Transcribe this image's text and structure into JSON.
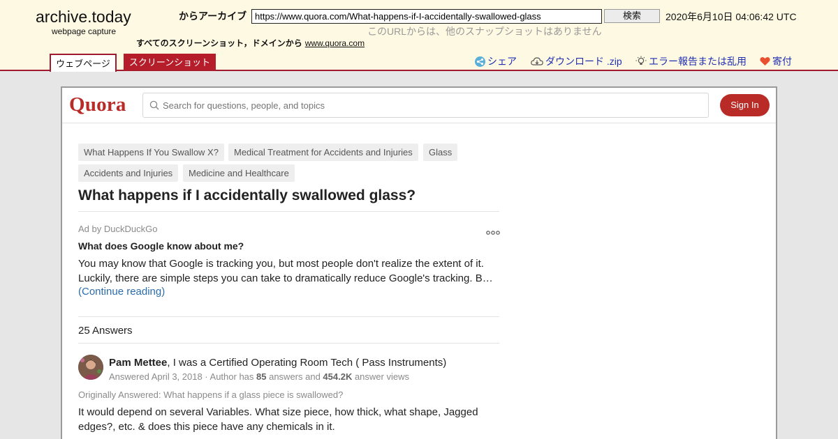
{
  "archive": {
    "logo": "archive.today",
    "logo_sub": "webpage capture",
    "from_label": "からアーカイブ",
    "url": "https://www.quora.com/What-happens-if-I-accidentally-swallowed-glass",
    "search_label": "検索",
    "date": "2020年6月10日 04:06:42 UTC",
    "no_other_snapshots": "このURLからは、他のスナップショットはありません",
    "all_screenshots_label": "すべてのスクリーンショット，ドメインから",
    "domain_link": "www.quora.com",
    "tabs": {
      "webpage": "ウェブページ",
      "screenshot": "スクリーンショット"
    },
    "actions": {
      "share": "シェア",
      "download": "ダウンロード .zip",
      "report": "エラー報告または乱用",
      "donate": "寄付"
    }
  },
  "quora": {
    "logo": "Quora",
    "search_placeholder": "Search for questions, people, and topics",
    "sign_in": "Sign In",
    "topics": [
      "What Happens If You Swallow X?",
      "Medical Treatment for Accidents and Injuries",
      "Glass",
      "Accidents and Injuries",
      "Medicine and Healthcare"
    ],
    "question_title": "What happens if I accidentally swallowed glass?",
    "ad": {
      "by": "Ad by DuckDuckGo",
      "title": "What does Google know about me?",
      "line1": "You may know that Google is tracking you, but most people don't realize the extent of it.",
      "line2": "Luckily, there are simple steps you can take to dramatically reduce Google's tracking. But…",
      "continue": "(Continue reading)"
    },
    "answers_count": "25 Answers",
    "answer": {
      "author_name": "Pam Mettee",
      "author_cred": ", I was a Certified Operating Room Tech ( Pass Instruments)",
      "meta_prefix": "Answered April 3, 2018 · Author has ",
      "answers_num": "85",
      "meta_mid": " answers and ",
      "views_num": "454.2K",
      "meta_suffix": " answer views",
      "originally_answered": "Originally Answered: What happens if a glass piece is swallowed?",
      "body_line1": "It would depend on several Variables. What size piece, how thick, what shape, Jagged",
      "body_line2": "edges?, etc. & does this piece have any chemicals in it."
    }
  },
  "colors": {
    "archive_bg": "#fef9e3",
    "archive_accent": "#a0192d",
    "quora_red": "#b92b27",
    "link_blue": "#2b6dad",
    "action_blue": "#2030b0"
  }
}
